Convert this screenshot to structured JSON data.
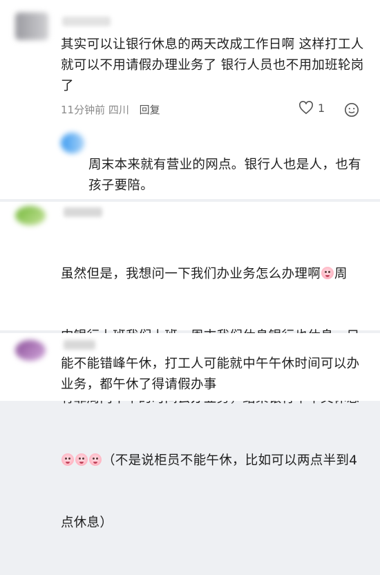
{
  "comment1": {
    "text": "其实可以让银行休息的两天改成工作日啊 这样打工人就可以不用请假办理业务了 银行人员也不用加班轮岗了",
    "time": "11分钟前",
    "location": "四川",
    "reply_label": "回复",
    "like_count": "1",
    "reply": {
      "text": "周末本来就有营业的网点。银行人也是人，也有孩子要陪。"
    }
  },
  "comment2": {
    "text_line1": "虽然但是，我想问一下我们办业务怎么办理啊",
    "text_line1b": "周",
    "text_line2": "内银行上班我们上班，周末我们休息银行也休息，只",
    "text_line3": "有靠周内中午的时间去办业务，结果银行中午又休息",
    "text_line4": "（不是说柜员不能午休，比如可以两点半到4",
    "text_line5": "点休息）",
    "emoji_name": "crying-face-emoji"
  },
  "comment3": {
    "text": "能不能错峰午休，打工人可能就中午午休时间可以办业务，都午休了得请假办事"
  },
  "colors": {
    "background": "#eef0f3",
    "card": "#ffffff",
    "meta_text": "#8a8a8a"
  }
}
